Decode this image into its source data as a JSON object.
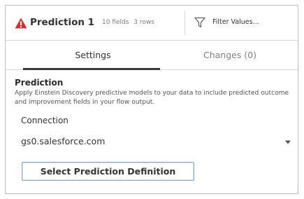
{
  "header": {
    "title": "Prediction 1",
    "fields": "10 fields",
    "rows": "3 rows",
    "filter_label": "Filter Values...",
    "icons": {
      "warning": "warning-triangle-icon",
      "filter": "funnel-icon"
    },
    "colors": {
      "warning": "#d62d2d"
    }
  },
  "tabs": [
    {
      "label": "Settings",
      "active": true
    },
    {
      "label": "Changes (0)",
      "active": false
    }
  ],
  "section": {
    "title": "Prediction",
    "description": "Apply Einstein Discovery predictive models to your data to include predicted outcome and improvement fields in your flow output."
  },
  "connection": {
    "label": "Connection",
    "value": "gs0.salesforce.com",
    "icon": "chevron-down-icon"
  },
  "actions": {
    "select_definition_label": "Select Prediction Definition"
  }
}
